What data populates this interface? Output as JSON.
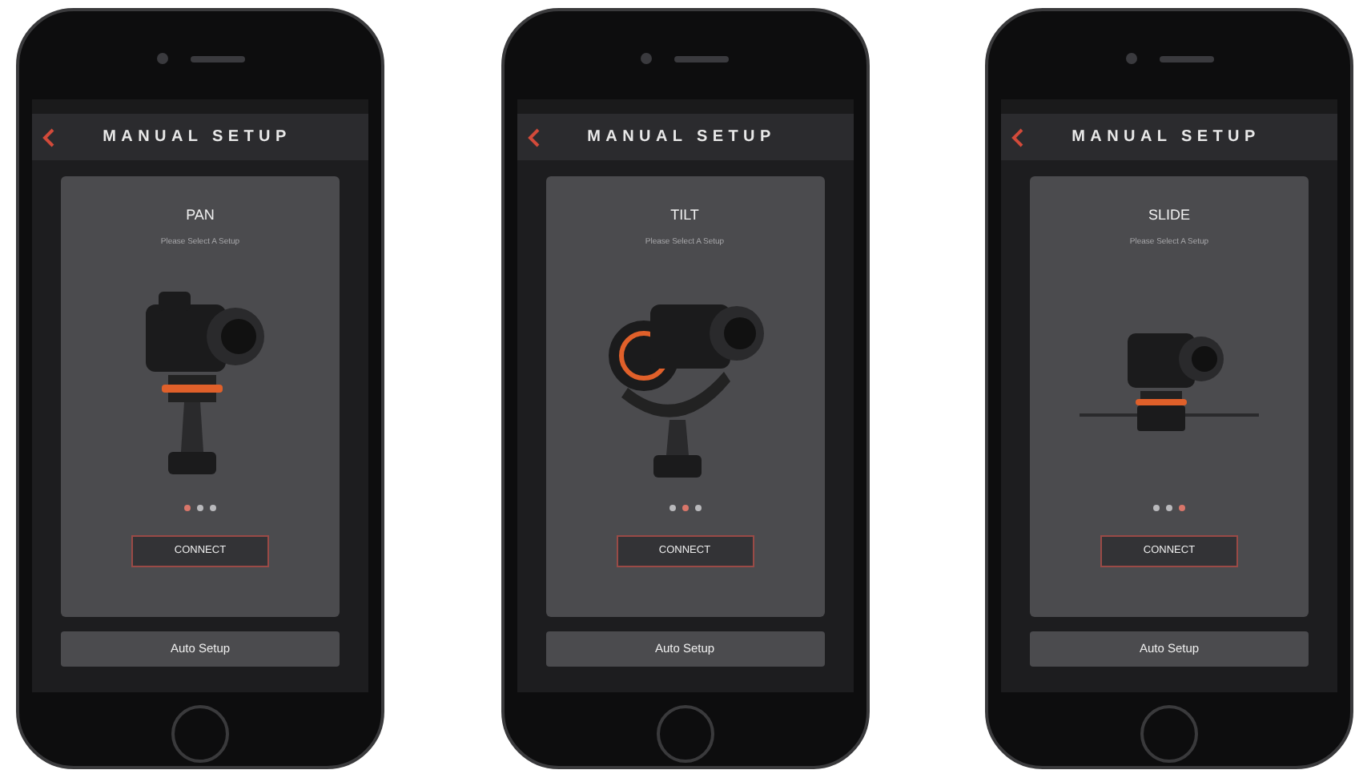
{
  "phones": [
    {
      "title": "MANUAL SETUP",
      "mode": "PAN",
      "subtitle": "Please Select A Setup",
      "kind": "pan",
      "dots": [
        {
          "selected": true
        },
        {
          "selected": false
        },
        {
          "selected": false
        }
      ],
      "connect": "CONNECT",
      "auto": "Auto Setup"
    },
    {
      "title": "MANUAL SETUP",
      "mode": "TILT",
      "subtitle": "Please Select A Setup",
      "kind": "tilt",
      "dots": [
        {
          "selected": false
        },
        {
          "selected": true
        },
        {
          "selected": false
        }
      ],
      "connect": "CONNECT",
      "auto": "Auto Setup"
    },
    {
      "title": "MANUAL SETUP",
      "mode": "SLIDE",
      "subtitle": "Please Select A Setup",
      "kind": "slide",
      "dots": [
        {
          "selected": false
        },
        {
          "selected": false
        },
        {
          "selected": true
        }
      ],
      "connect": "CONNECT",
      "auto": "Auto Setup"
    }
  ]
}
